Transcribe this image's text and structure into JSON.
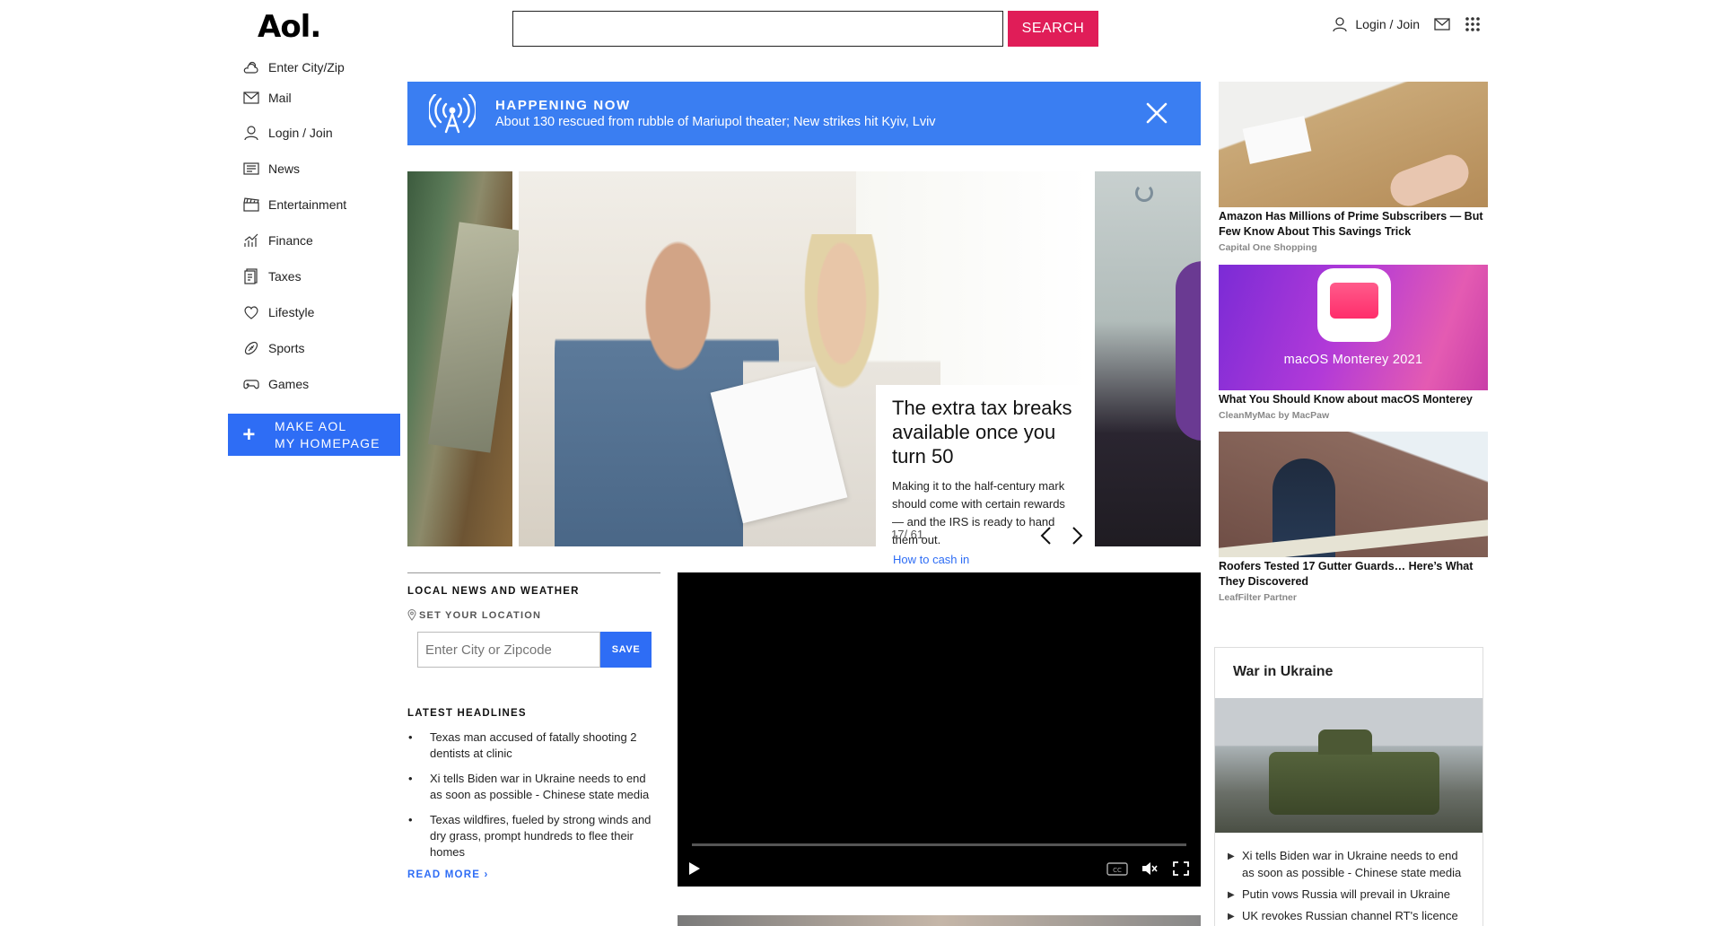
{
  "header": {
    "logo": "Aol.",
    "search_placeholder": "",
    "search_button": "SEARCH",
    "login_label": "Login / Join"
  },
  "leftnav": {
    "items": [
      {
        "label": "Enter City/Zip",
        "icon": "weather-icon"
      },
      {
        "label": "Mail",
        "icon": "mail-icon"
      },
      {
        "label": "Login / Join",
        "icon": "user-icon"
      },
      {
        "label": "News",
        "icon": "news-icon"
      },
      {
        "label": "Entertainment",
        "icon": "clapperboard-icon"
      },
      {
        "label": "Finance",
        "icon": "chart-icon"
      },
      {
        "label": "Taxes",
        "icon": "taxes-icon"
      },
      {
        "label": "Lifestyle",
        "icon": "heart-icon"
      },
      {
        "label": "Sports",
        "icon": "football-icon"
      },
      {
        "label": "Games",
        "icon": "gamepad-icon"
      }
    ],
    "make_homepage_line1": "MAKE AOL",
    "make_homepage_line2": "MY HOMEPAGE"
  },
  "happening": {
    "title": "HAPPENING NOW",
    "text": "About 130 rescued from rubble of Mariupol theater; New strikes hit Kyiv, Lviv"
  },
  "carousel": {
    "title": "The extra tax breaks available once you turn 50",
    "description": "Making it to the half-century mark should come with certain rewards — and the IRS is ready to hand them out.",
    "link": "How to cash in",
    "counter": "17/ 61"
  },
  "local": {
    "heading": "LOCAL NEWS AND WEATHER",
    "set_location": "SET YOUR LOCATION",
    "zip_placeholder": "Enter City or Zipcode",
    "save": "SAVE",
    "latest_heading": "LATEST HEADLINES",
    "headlines": [
      "Texas man accused of fatally shooting 2 dentists at clinic",
      "Xi tells Biden war in Ukraine needs to end as soon as possible - Chinese state media",
      "Texas wildfires, fueled by strong winds and dry grass, prompt hundreds to flee their homes"
    ],
    "read_more": "READ MORE ›"
  },
  "ads": [
    {
      "title": "Amazon Has Millions of Prime Subscribers — But Few Know About This Savings Trick",
      "source": "Capital One Shopping"
    },
    {
      "title": "What You Should Know about macOS Monterey",
      "source": "CleanMyMac by MacPaw",
      "image_text": "macOS Monterey 2021"
    },
    {
      "title": "Roofers Tested 17 Gutter Guards… Here’s What They Discovered",
      "source": "LeafFilter Partner"
    }
  ],
  "ukraine": {
    "heading": "War in Ukraine",
    "items": [
      "Xi tells Biden war in Ukraine needs to end as soon as possible - Chinese state media",
      "Putin vows Russia will prevail in Ukraine",
      "UK revokes Russian channel RT's licence"
    ]
  },
  "colors": {
    "accent_blue": "#2e6df5",
    "search_red": "#e01d58",
    "happening_blue": "#3a7ef2"
  }
}
